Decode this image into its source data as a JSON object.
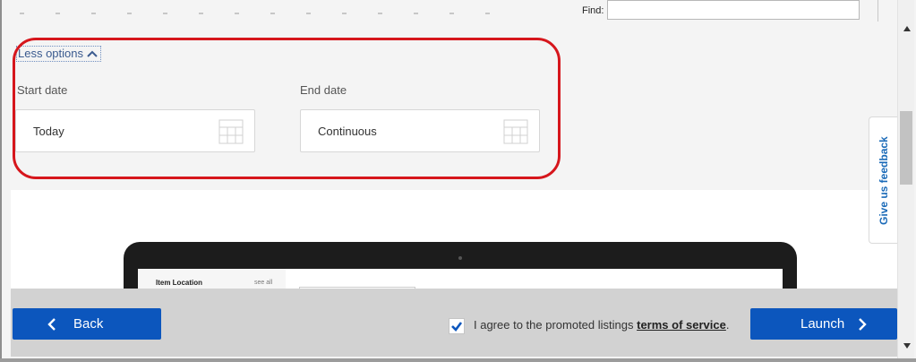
{
  "findbar": {
    "label": "Find:",
    "value": ""
  },
  "options": {
    "toggle_label": "Less options",
    "toggle_icon": "chevron-up-icon"
  },
  "start_date": {
    "label": "Start date",
    "value": "Today",
    "icon": "calendar-icon"
  },
  "end_date": {
    "label": "End date",
    "value": "Continuous",
    "icon": "calendar-icon"
  },
  "preview": {
    "item_location": "Item Location",
    "see_all": "see all"
  },
  "feedback": {
    "label": "Give us feedback"
  },
  "footer": {
    "back_label": "Back",
    "launch_label": "Launch",
    "agree_prefix": "I agree to the promoted listings ",
    "agree_link": "terms of service",
    "agree_suffix": ".",
    "agree_checked": true
  },
  "colors": {
    "accent": "#0c56bd",
    "highlight": "#d6161c",
    "link": "#1a6ab8"
  }
}
